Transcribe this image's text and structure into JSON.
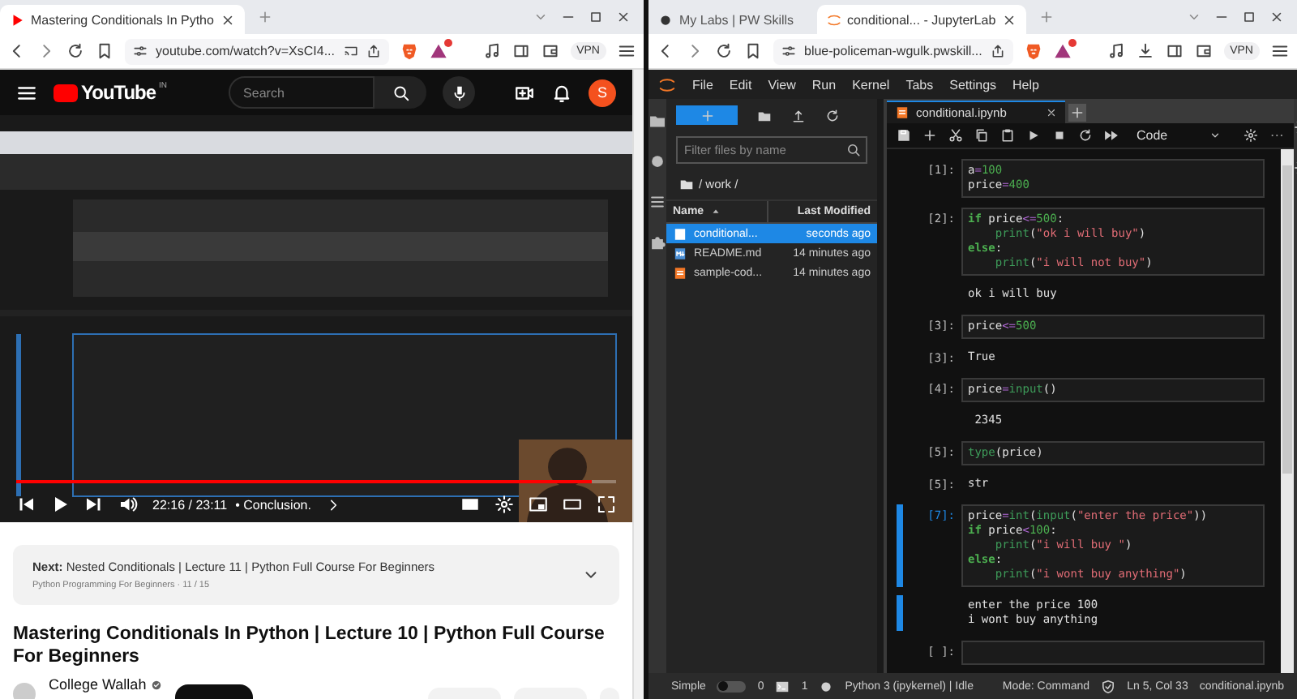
{
  "left_window": {
    "tab": {
      "title": "Mastering Conditionals In Pytho",
      "selected": true
    },
    "address": "youtube.com/watch?v=XsCI4...",
    "vpn": "VPN",
    "youtube": {
      "logo": "YouTube",
      "region": "IN",
      "search_placeholder": "Search",
      "avatar": "S"
    },
    "player": {
      "time": "22:16 / 23:11",
      "chapter": "• Conclusion.",
      "progress": {
        "level": 0.96
      }
    },
    "next_card": {
      "title": "**Next:** Nested Conditionals | Lecture 11 | Python Full Course For Beginners",
      "playlist": "Python Programming For Beginners · 11 / 15"
    },
    "video_title": "Mastering Conditionals In Python | Lecture 10 | Python Full Course For Beginners",
    "channel": "College Wallah"
  },
  "right_window": {
    "tabs": [
      {
        "title": "My Labs | PW Skills",
        "selected": false
      },
      {
        "title": "conditional... - JupyterLab",
        "selected": true
      }
    ],
    "address": "blue-policeman-wgulk.pwskill...",
    "vpn": "VPN",
    "menu": [
      "File",
      "Edit",
      "View",
      "Run",
      "Kernel",
      "Tabs",
      "Settings",
      "Help"
    ],
    "file_browser": {
      "filter_placeholder": "Filter files by name",
      "path": "/ work /",
      "columns": [
        "Name",
        "Last Modified"
      ],
      "files": [
        {
          "name": "conditional...",
          "modified": "seconds ago",
          "kind": "notebook",
          "selected": true
        },
        {
          "name": "README.md",
          "modified": "14 minutes ago",
          "kind": "markdown",
          "selected": false
        },
        {
          "name": "sample-cod...",
          "modified": "14 minutes ago",
          "kind": "notebook",
          "selected": false
        }
      ]
    },
    "notebook": {
      "tab": "conditional.ipynb",
      "cell_type": "Code",
      "cells": [
        {
          "prompt": "[1]:",
          "source": [
            "a=100",
            "price=400"
          ],
          "selected": false
        },
        {
          "prompt": "[2]:",
          "source": [
            "if price<=500:",
            "    print(\"ok i will buy\")",
            "else:",
            "    print(\"i will not buy\")"
          ],
          "selected": false,
          "output": {
            "lines": [
              "ok i will buy"
            ]
          }
        },
        {
          "prompt": "[3]:",
          "source": [
            "price<=500"
          ],
          "selected": false,
          "output": {
            "prompt": "[3]:",
            "lines": [
              "True"
            ]
          }
        },
        {
          "prompt": "[4]:",
          "source": [
            "price=input()"
          ],
          "selected": false,
          "output": {
            "lines": [
              " 2345"
            ]
          }
        },
        {
          "prompt": "[5]:",
          "source": [
            "type(price)"
          ],
          "selected": false,
          "output": {
            "prompt": "[5]:",
            "lines": [
              "str"
            ]
          }
        },
        {
          "prompt": "[7]:",
          "source": [
            "price=int(input(\"enter the price\"))",
            "if price<100:",
            "    print(\"i will buy \")",
            "else:",
            "    print(\"i wont buy anything\")"
          ],
          "selected": true,
          "output": {
            "lines": [
              "enter the price 100",
              "i wont buy anything"
            ]
          }
        },
        {
          "prompt": "[ ]:",
          "selected": false
        }
      ]
    },
    "status_bar": {
      "mode_label": "Simple",
      "simple_on": false,
      "terminals": "0",
      "kernels": "1",
      "kernel": "Python 3 (ipykernel) | Idle",
      "mode": "Mode: Command",
      "cursor": "Ln 5, Col 33",
      "file": "conditional.ipynb"
    }
  }
}
